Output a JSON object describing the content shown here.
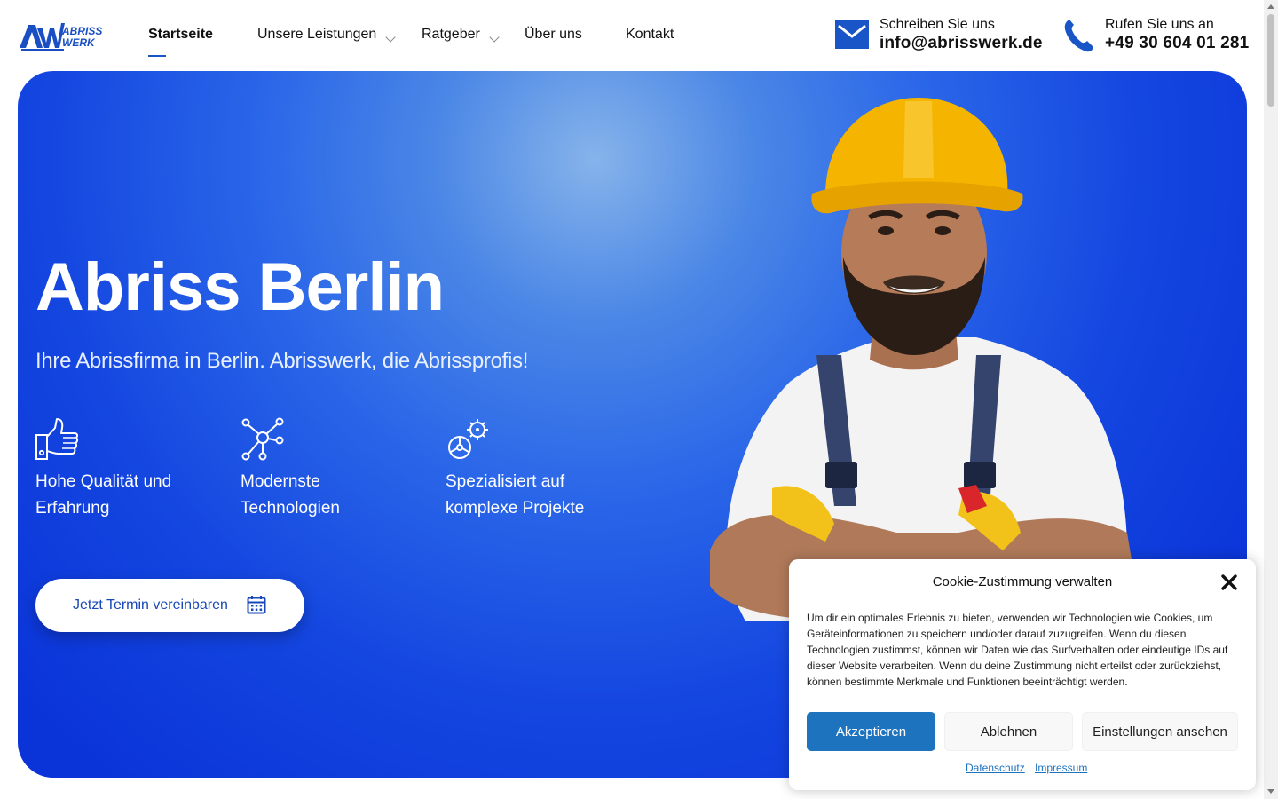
{
  "logo": {
    "mark": "AW",
    "line1": "ABRISS",
    "line2": "WERK"
  },
  "nav": {
    "items": [
      {
        "label": "Startseite",
        "active": true,
        "has_dropdown": false
      },
      {
        "label": "Unsere Leistungen",
        "active": false,
        "has_dropdown": true
      },
      {
        "label": "Ratgeber",
        "active": false,
        "has_dropdown": true
      },
      {
        "label": "Über uns",
        "active": false,
        "has_dropdown": false
      },
      {
        "label": "Kontakt",
        "active": false,
        "has_dropdown": false
      }
    ]
  },
  "contact": {
    "email": {
      "label": "Schreiben Sie uns",
      "value": "info@abrisswerk.de",
      "icon": "mail-icon"
    },
    "phone": {
      "label": "Rufen Sie uns an",
      "value": "+49 30 604 01 281",
      "icon": "phone-icon"
    }
  },
  "hero": {
    "title": "Abriss Berlin",
    "subtitle": "Ihre Abrissfirma in Berlin. Abrisswerk, die Abrissprofis!",
    "features": [
      {
        "line1": "Hohe Qualität und",
        "line2": "Erfahrung",
        "icon": "thumbs-up-icon"
      },
      {
        "line1": "Modernste",
        "line2": "Technologien",
        "icon": "network-icon"
      },
      {
        "line1": "Spezialisiert auf",
        "line2": "komplexe Projekte",
        "icon": "gears-icon"
      }
    ],
    "cta": {
      "label": "Jetzt Termin vereinbaren",
      "icon": "calendar-icon"
    }
  },
  "cookie": {
    "title": "Cookie-Zustimmung verwalten",
    "text": "Um dir ein optimales Erlebnis zu bieten, verwenden wir Technologien wie Cookies, um Geräteinformationen zu speichern und/oder darauf zuzugreifen. Wenn du diesen Technologien zustimmst, können wir Daten wie das Surfverhalten oder eindeutige IDs auf dieser Website verarbeiten. Wenn du deine Zustimmung nicht erteilst oder zurückziehst, können bestimmte Merkmale und Funktionen beeinträchtigt werden.",
    "accept": "Akzeptieren",
    "deny": "Ablehnen",
    "prefs": "Einstellungen ansehen",
    "links": [
      "Datenschutz",
      "Impressum"
    ]
  },
  "colors": {
    "accent": "#1a55c8",
    "hero_blue": "#0a33d8",
    "button_blue": "#1e73be",
    "helmet_yellow": "#f5b400"
  }
}
